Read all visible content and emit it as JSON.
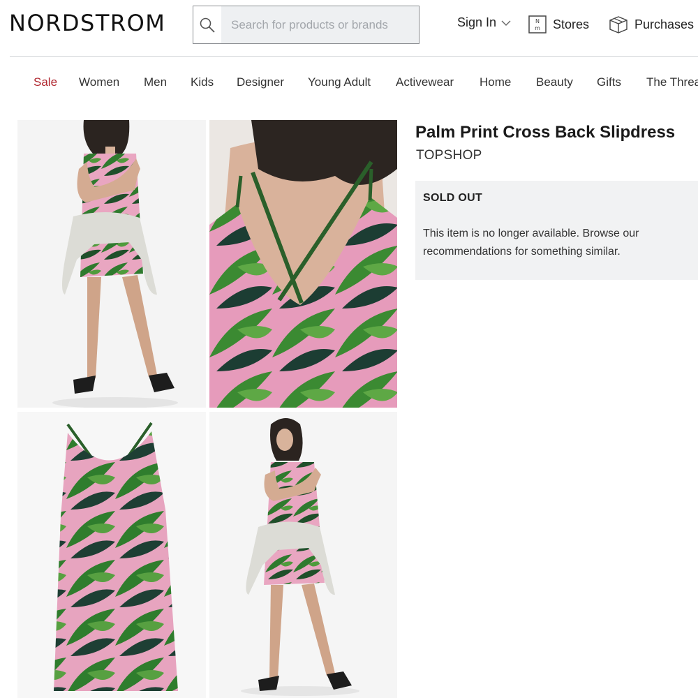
{
  "header": {
    "logo": "NORDSTROM",
    "search_placeholder": "Search for products or brands",
    "sign_in": "Sign In",
    "stores": "Stores",
    "purchases": "Purchases"
  },
  "categories": [
    "Sale",
    "Women",
    "Men",
    "Kids",
    "Designer",
    "Young Adult",
    "Activewear",
    "Home",
    "Beauty",
    "Gifts",
    "The Threa"
  ],
  "product": {
    "title": "Palm Print Cross Back Slipdress",
    "brand": "TOPSHOP",
    "status_title": "SOLD OUT",
    "status_message": "This item is no longer available. Browse our recommendations for something similar."
  },
  "colors": {
    "sale": "#b0272f",
    "palm_green": "#2f7a2e",
    "print_pink": "#e9a6c1"
  }
}
